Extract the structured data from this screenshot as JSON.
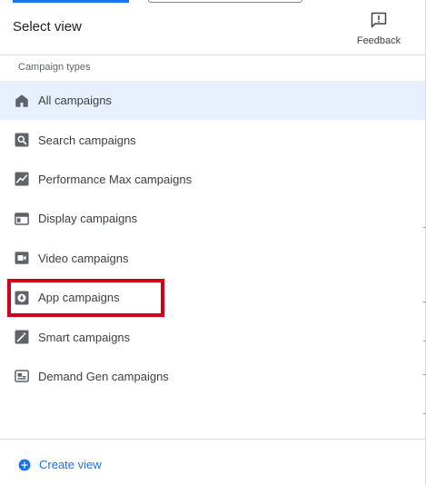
{
  "header": {
    "title": "Select view",
    "feedback_label": "Feedback"
  },
  "section_label": "Campaign types",
  "items": [
    {
      "label": "All campaigns",
      "icon": "home-icon",
      "selected": true
    },
    {
      "label": "Search campaigns",
      "icon": "search-icon",
      "selected": false
    },
    {
      "label": "Performance Max campaigns",
      "icon": "trending-icon",
      "selected": false
    },
    {
      "label": "Display campaigns",
      "icon": "display-icon",
      "selected": false
    },
    {
      "label": "Video campaigns",
      "icon": "video-icon",
      "selected": false
    },
    {
      "label": "App campaigns",
      "icon": "app-download-icon",
      "selected": false
    },
    {
      "label": "Smart campaigns",
      "icon": "magic-wand-icon",
      "selected": false
    },
    {
      "label": "Demand Gen campaigns",
      "icon": "demand-gen-icon",
      "selected": false
    }
  ],
  "footer": {
    "create_label": "Create view"
  },
  "colors": {
    "accent": "#1a73e8",
    "selected_bg": "#e8f0fe",
    "highlight": "#d0021b",
    "icon": "#5f6368"
  }
}
